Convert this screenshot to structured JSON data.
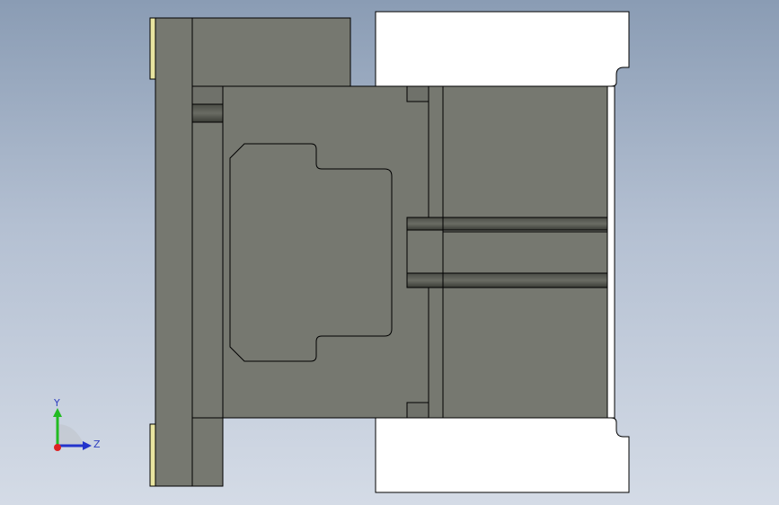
{
  "view": {
    "background_top": "#8a9cb4",
    "background_bottom": "#d4dbe6",
    "body_color": "#767870",
    "edge_color": "#000000",
    "terminal_color": "#ffffff",
    "rail_accent": "#e8e4a0"
  },
  "triad": {
    "y_label": "Y",
    "z_label": "Z",
    "y_color": "#22bb22",
    "z_color": "#2233cc",
    "x_color": "#dd2222"
  }
}
